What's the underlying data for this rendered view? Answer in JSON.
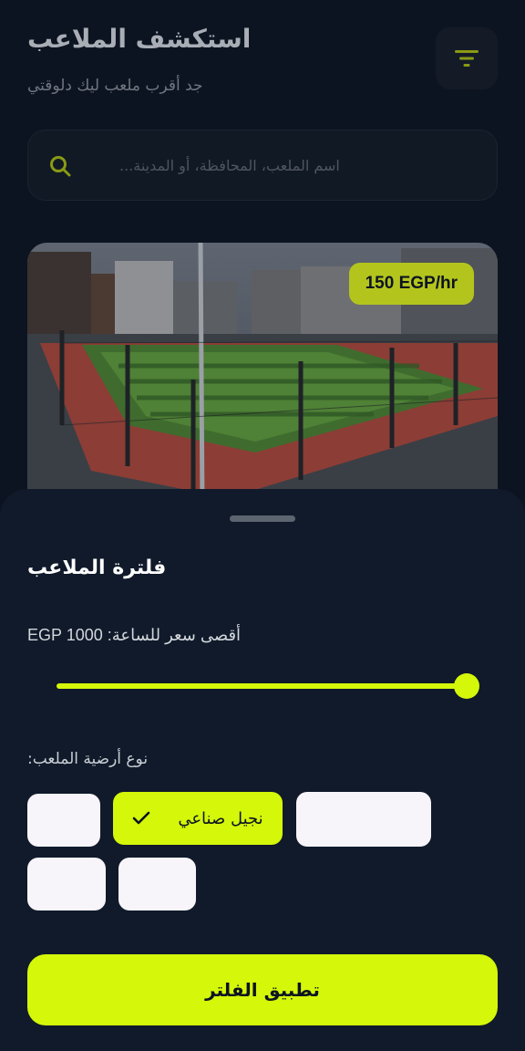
{
  "header": {
    "title": "استكشف الملاعب",
    "subtitle": "جد أقرب ملعب ليك دلوقتي",
    "filter_icon": "filter-icon"
  },
  "search": {
    "placeholder": "اسم الملعب، المحافظة، أو المدينة..."
  },
  "card": {
    "price": "150 EGP/hr"
  },
  "filter_sheet": {
    "title": "فلترة الملاعب",
    "max_price_label": "EGP أقصى سعر للساعة: 1000",
    "max_price_fraction": 1.0,
    "surface_label": "نوع أرضية الملعب:",
    "chips": [
      {
        "label": "",
        "selected": false
      },
      {
        "label": "نجيل صناعي",
        "selected": true
      },
      {
        "label": "",
        "selected": false
      },
      {
        "label": "",
        "selected": false
      },
      {
        "label": "",
        "selected": false
      }
    ],
    "apply_label": "تطبيق الفلتر"
  },
  "colors": {
    "accent": "#d4f70a",
    "background": "#0d1421",
    "sheet": "#101a2a"
  }
}
